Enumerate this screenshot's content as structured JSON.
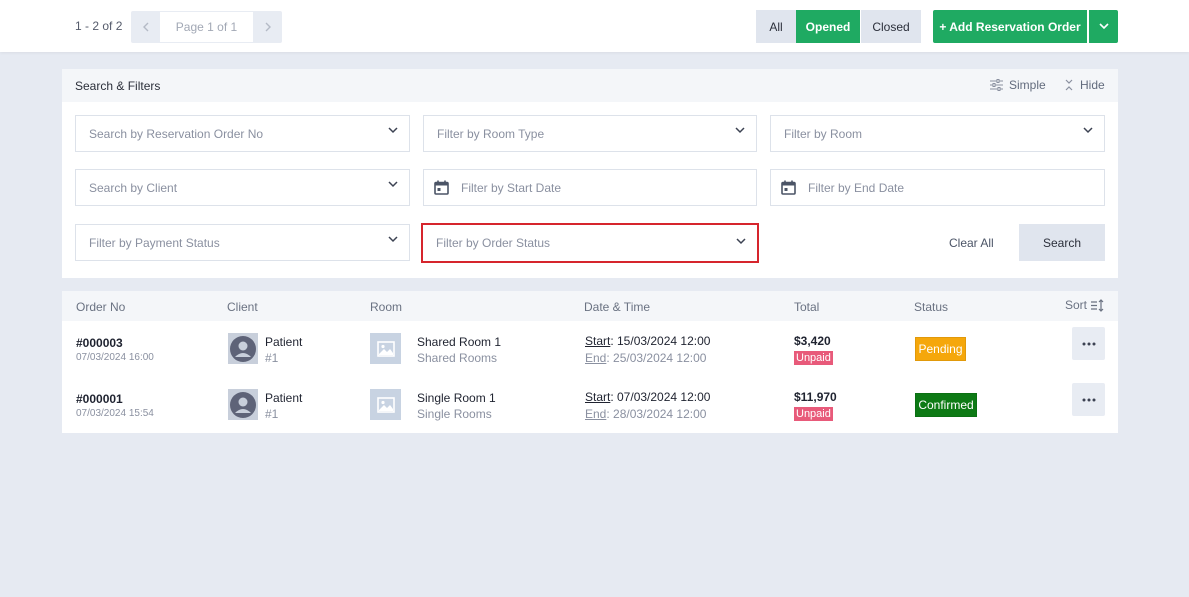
{
  "pager": {
    "count": "1 - 2 of 2",
    "page_label": "Page 1 of 1",
    "prev_icon": "chevron-left-icon",
    "next_icon": "chevron-right-icon"
  },
  "tabs": {
    "all": "All",
    "opened": "Opened",
    "closed": "Closed"
  },
  "add_button": {
    "label": "+ Add Reservation Order"
  },
  "filters": {
    "title": "Search & Filters",
    "simple_label": "Simple",
    "hide_label": "Hide",
    "reservation_no": "Search by Reservation Order No",
    "room_type": "Filter by Room Type",
    "room": "Filter by Room",
    "client": "Search by Client",
    "start_date": "Filter by Start Date",
    "end_date": "Filter by End Date",
    "payment_status": "Filter by Payment Status",
    "order_status": "Filter by Order Status",
    "clear_all": "Clear All",
    "search": "Search"
  },
  "table": {
    "headers": {
      "order_no": "Order No",
      "client": "Client",
      "room": "Room",
      "date_time": "Date & Time",
      "total": "Total",
      "status": "Status",
      "sort": "Sort"
    },
    "rows": [
      {
        "order_no": "#000003",
        "created": "07/03/2024 16:00",
        "client_name": "Patient",
        "client_id": "#1",
        "room_name": "Shared Room 1",
        "room_type": "Shared Rooms",
        "start_label": "Start",
        "start": ": 15/03/2024 12:00",
        "end_label": "End",
        "end": ": 25/03/2024 12:00",
        "total": "$3,420",
        "payment": "Unpaid",
        "status": "Pending"
      },
      {
        "order_no": "#000001",
        "created": "07/03/2024 15:54",
        "client_name": "Patient",
        "client_id": "#1",
        "room_name": "Single Room 1",
        "room_type": "Single Rooms",
        "start_label": "Start",
        "start": ": 07/03/2024 12:00",
        "end_label": "End",
        "end": ": 28/03/2024 12:00",
        "total": "$11,970",
        "payment": "Unpaid",
        "status": "Confirmed"
      }
    ]
  },
  "colors": {
    "accent": "#1faa62",
    "pending": "#f5a70b",
    "confirmed": "#0d7a15",
    "unpaid": "#e85a7a",
    "highlight": "#d6252d"
  }
}
